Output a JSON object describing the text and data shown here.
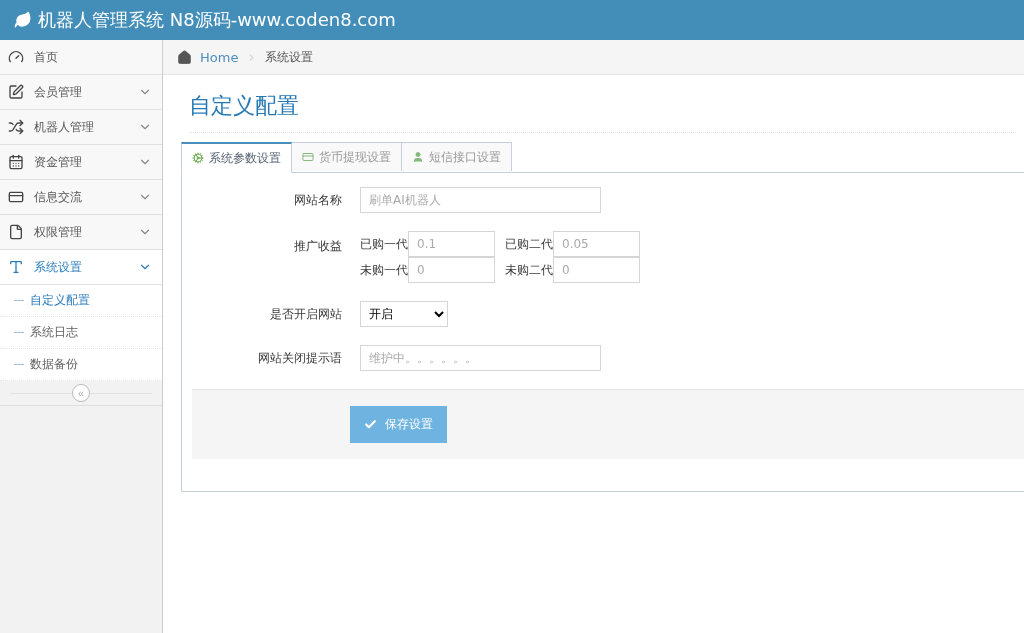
{
  "header": {
    "title": "机器人管理系统 N8源码-www.coden8.com"
  },
  "sidebar": {
    "items": [
      {
        "label": "首页",
        "selected": false,
        "expandable": false
      },
      {
        "label": "会员管理",
        "selected": false,
        "expandable": true
      },
      {
        "label": "机器人管理",
        "selected": false,
        "expandable": true
      },
      {
        "label": "资金管理",
        "selected": false,
        "expandable": true
      },
      {
        "label": "信息交流",
        "selected": false,
        "expandable": true
      },
      {
        "label": "权限管理",
        "selected": false,
        "expandable": true
      },
      {
        "label": "系统设置",
        "selected": true,
        "expandable": true,
        "expanded": true,
        "children": [
          {
            "label": "自定义配置",
            "selected": true
          },
          {
            "label": "系统日志",
            "selected": false
          },
          {
            "label": "数据备份",
            "selected": false
          }
        ]
      }
    ],
    "collapse_button": "«"
  },
  "breadcrumb": [
    {
      "label": "Home",
      "link": true
    },
    {
      "label": "系统设置",
      "link": false
    }
  ],
  "page_title": "自定义配置",
  "tabs": [
    {
      "label": "系统参数设置",
      "selected": true
    },
    {
      "label": "货币提现设置",
      "selected": false
    },
    {
      "label": "短信接口设置",
      "selected": false
    }
  ],
  "form": {
    "site_name": {
      "label": "网站名称",
      "placeholder": "刷单AI机器人"
    },
    "promotion": {
      "label": "推广收益",
      "fields": [
        {
          "label": "已购一代",
          "placeholder": "0.1"
        },
        {
          "label": "已购二代",
          "placeholder": "0.05"
        },
        {
          "label": "未购一代",
          "placeholder": "0"
        },
        {
          "label": "未购二代",
          "placeholder": "0"
        }
      ]
    },
    "site_open": {
      "label": "是否开启网站",
      "value": "开启"
    },
    "close_message": {
      "label": "网站关闭提示语",
      "placeholder": "维护中。。。。。。"
    },
    "save_button": "保存设置"
  }
}
